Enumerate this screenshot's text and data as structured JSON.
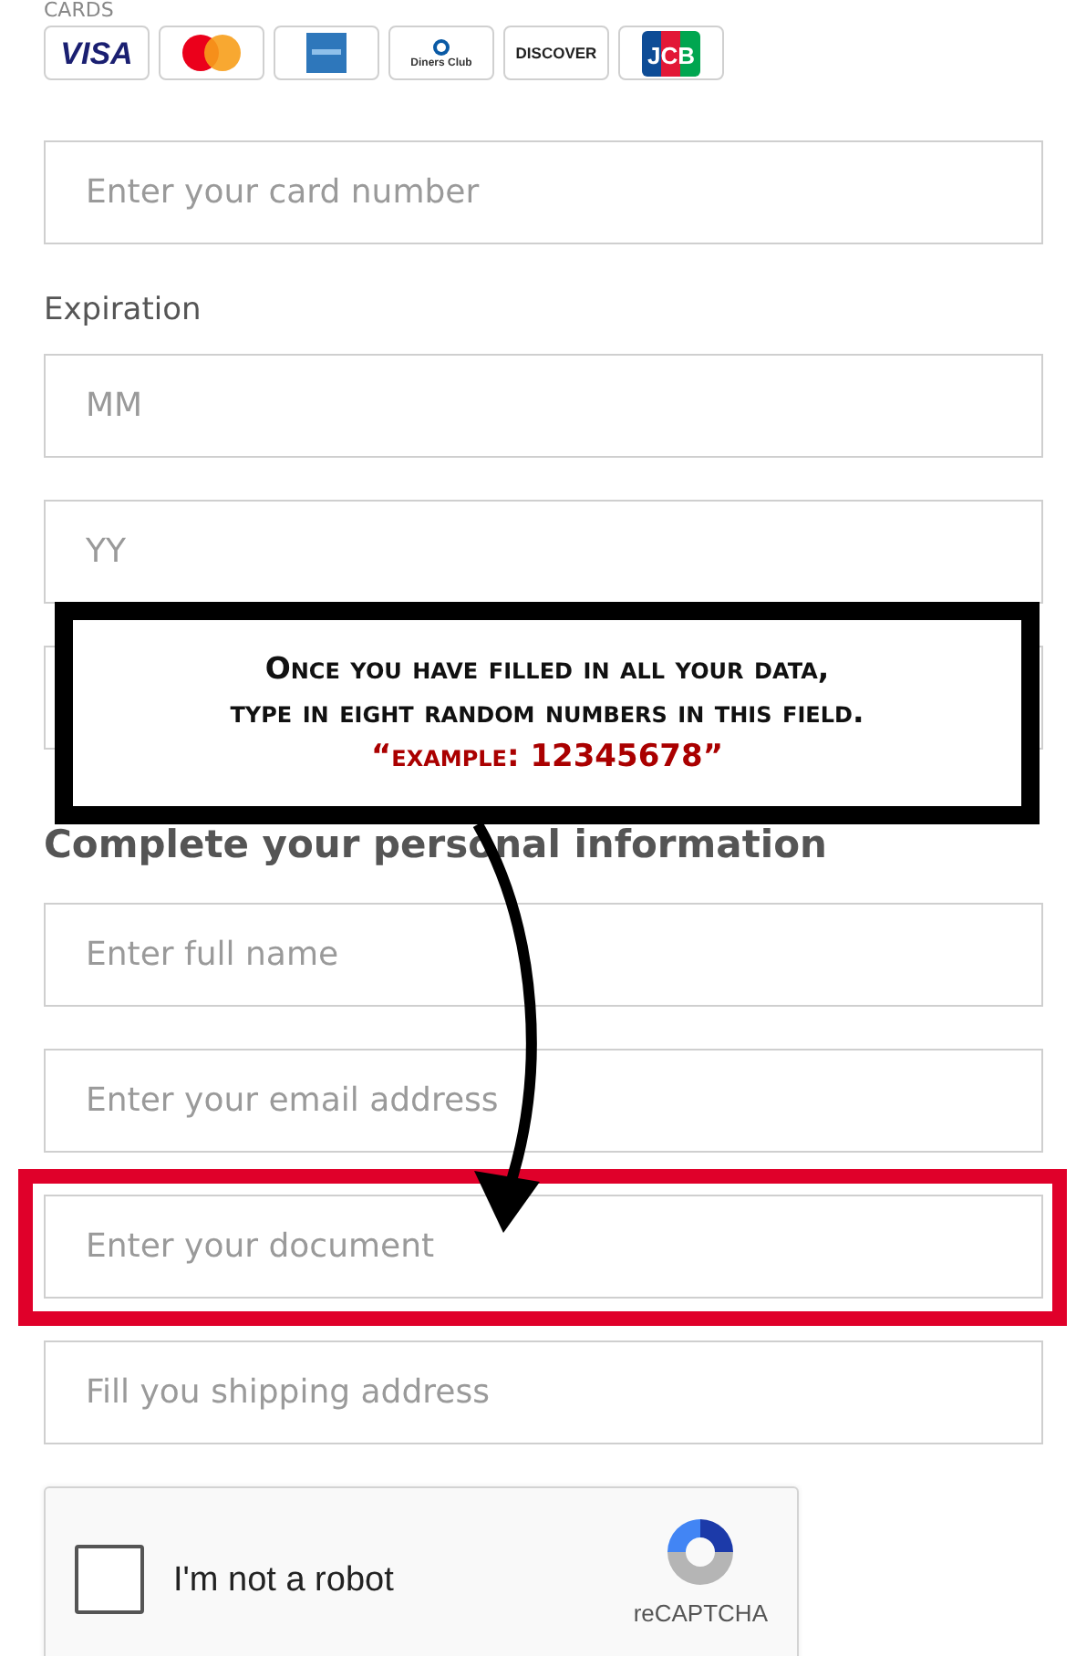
{
  "cards": {
    "label": "CARDS",
    "logos": [
      {
        "kind": "visa",
        "text": "VISA"
      },
      {
        "kind": "mastercard"
      },
      {
        "kind": "amex"
      },
      {
        "kind": "diners",
        "text": "Diners Club"
      },
      {
        "kind": "discover",
        "text": "DISCOVER"
      },
      {
        "kind": "jcb",
        "text": "JCB"
      }
    ]
  },
  "card_number": {
    "placeholder": "Enter your card number"
  },
  "expiration": {
    "label": "Expiration",
    "fields": [
      {
        "kind": "field",
        "placeholder": "MM"
      },
      {
        "kind": "field",
        "placeholder": "YY"
      },
      {
        "kind": "covered"
      }
    ]
  },
  "personal": {
    "heading": "Complete your personal information",
    "fields": [
      {
        "placeholder": "Enter full name",
        "highlighted": false
      },
      {
        "placeholder": "Enter your email address",
        "highlighted": false
      },
      {
        "placeholder": "Enter your document",
        "highlighted": true
      },
      {
        "placeholder": "Fill you shipping address",
        "highlighted": false
      }
    ]
  },
  "captcha": {
    "checked": false,
    "label": "I'm not a robot",
    "brand": "reCAPTCHA"
  },
  "annotation": {
    "lines": [
      "Once you have filled in all your data,",
      "type in eight random numbers in this field."
    ],
    "example": "“example: 12345678”"
  }
}
